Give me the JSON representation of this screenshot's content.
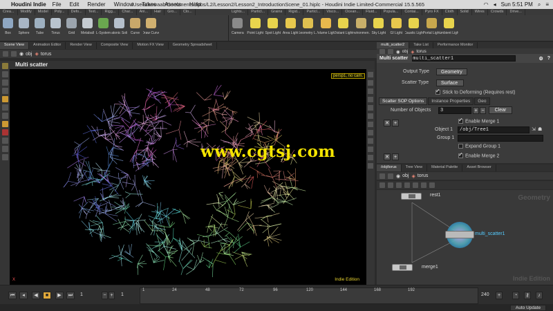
{
  "menubar": {
    "app_name": "Houdini Indie",
    "items": [
      "File",
      "Edit",
      "Render",
      "Window",
      "Takes",
      "Assets",
      "Help"
    ],
    "window_title": "/Users/aswaab/Documents/Jobs/L2/Lesson2/Lesson2_IntroductionScene_01.hiplc - Houdini Indie Limited-Commercial 15.5.565",
    "clock": "Sun 5:51 PM"
  },
  "shelf_tabs_left": [
    "Crea...",
    "Modify",
    "Model",
    "Poly...",
    "Defo...",
    "Text...",
    "Rigg...",
    "Char...",
    "Ani...",
    "Hair",
    "Gro...",
    "Clo..."
  ],
  "shelf_tabs_right": [
    "Lights...",
    "Particl...",
    "Grains",
    "Rigid...",
    "Particl...",
    "Visco...",
    "Ocean...",
    "Fluid...",
    "Popula...",
    "Contai...",
    "Pyro FX",
    "Cloth",
    "Solid",
    "Wires",
    "Crowds",
    "Drive..."
  ],
  "shelf_tools_left": [
    {
      "label": "Box",
      "color": "#8fa7c2"
    },
    {
      "label": "Sphere",
      "color": "#a8b5c4"
    },
    {
      "label": "Tube",
      "color": "#9eb0c0"
    },
    {
      "label": "Torus",
      "color": "#b9c4cf"
    },
    {
      "label": "Grid",
      "color": "#9ca5ae"
    },
    {
      "label": "Metaball",
      "color": "#c5cbd1"
    },
    {
      "label": "L-System",
      "color": "#6aa84f"
    },
    {
      "label": "Platonic Soli...",
      "color": "#b5bfcb"
    },
    {
      "label": "Curve",
      "color": "#c9a86a"
    },
    {
      "label": "Draw Curve",
      "color": "#d0b070"
    }
  ],
  "shelf_tools_right": [
    {
      "label": "Camera",
      "color": "#8a8a8a"
    },
    {
      "label": "Point Light",
      "color": "#e8d44d"
    },
    {
      "label": "Spot Light",
      "color": "#e8d44d"
    },
    {
      "label": "Area Light",
      "color": "#e8c84d"
    },
    {
      "label": "Geometry L...",
      "color": "#e0c050"
    },
    {
      "label": "Volume Light",
      "color": "#e8b84d"
    },
    {
      "label": "Distant Light",
      "color": "#e8d44d"
    },
    {
      "label": "Environmen...",
      "color": "#c9b06a"
    },
    {
      "label": "Sky Light",
      "color": "#e8d44d"
    },
    {
      "label": "GI Light",
      "color": "#e8c84d"
    },
    {
      "label": "Caustic Light",
      "color": "#e8d44d"
    },
    {
      "label": "Portal Light",
      "color": "#c8a84d"
    },
    {
      "label": "Ambient Light",
      "color": "#e8d44d"
    }
  ],
  "viewer_tabs": [
    "Scene View",
    "Animation Editor",
    "Render View",
    "Composite View",
    "Motion FX View",
    "Geometry Spreadsheet"
  ],
  "viewer_path": {
    "context": "obj",
    "node": "torus"
  },
  "viewer": {
    "title": "Multi scatter",
    "camera_badge": "persp1, no cam.",
    "edition_label": "Indie Edition",
    "watermark": "www.cgtsj.com",
    "axis_label": "X"
  },
  "param_tabs": [
    "multi_scatter2",
    "Take List",
    "Performance Monitor"
  ],
  "param_path": {
    "context": "obj",
    "node": "torus"
  },
  "params": {
    "node_type": "Multi scatter",
    "node_name": "multi_scatter1",
    "output_type_label": "Output Type",
    "output_type_value": "Geometry",
    "scatter_type_label": "Scatter Type",
    "scatter_type_value": "Surface",
    "stick_label": "Stick to Deforming (Requires rest)",
    "subtabs": [
      "Scatter SOP Options",
      "Instance Properties",
      "Geo"
    ],
    "num_objects_label": "Number of Objects",
    "num_objects_value": "3",
    "clear_label": "Clear",
    "enable_merge1_label": "Enable Merge 1",
    "object1_label": "Object 1",
    "object1_value": "/obj/Tree1",
    "group1_label": "Group 1",
    "expand_group1_label": "Expand Group 1",
    "enable_merge2_label": "Enable Merge 2"
  },
  "network_tabs": [
    "/obj/torus",
    "Tree View",
    "Material Palette",
    "Asset Browser"
  ],
  "network_path": {
    "context": "obj",
    "node": "torus"
  },
  "network": {
    "context_label": "Geometry",
    "edition_label": "Indie Edition",
    "nodes": [
      "rest1",
      "multi_scatter1",
      "merge1"
    ]
  },
  "timeline": {
    "current_frame": "1",
    "start_frame": "1",
    "end_frame": "240",
    "ticks": [
      "1",
      "24",
      "48",
      "72",
      "96",
      "120",
      "144",
      "168",
      "192"
    ],
    "auto_update_label": "Auto Update"
  }
}
